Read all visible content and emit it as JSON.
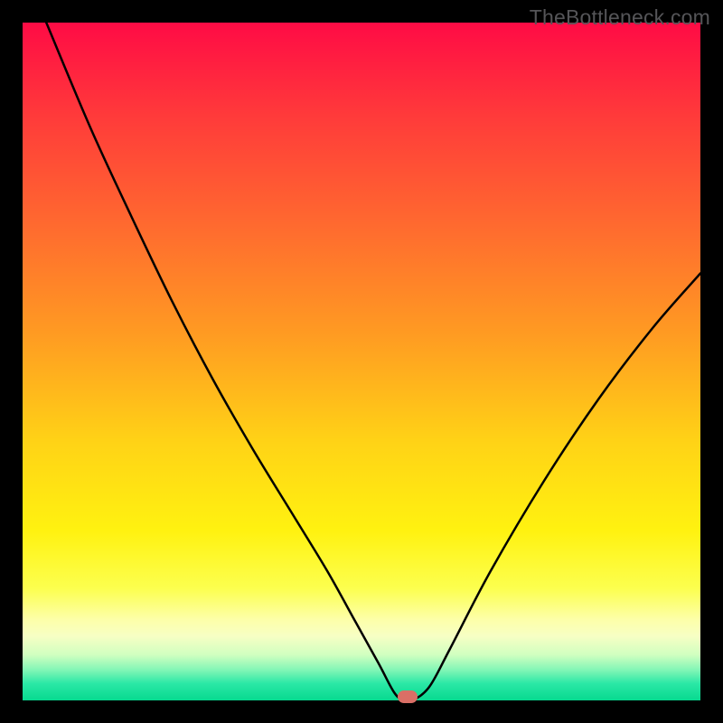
{
  "watermark": "TheBottleneck.com",
  "colors": {
    "frame": "#000000",
    "curve": "#000000",
    "marker": "#da6f66",
    "gradient_stops": [
      {
        "offset": 0.0,
        "hex": "#ff0b45"
      },
      {
        "offset": 0.14,
        "hex": "#ff3b3a"
      },
      {
        "offset": 0.3,
        "hex": "#ff6a2f"
      },
      {
        "offset": 0.46,
        "hex": "#ff9b22"
      },
      {
        "offset": 0.62,
        "hex": "#ffd316"
      },
      {
        "offset": 0.75,
        "hex": "#fff210"
      },
      {
        "offset": 0.835,
        "hex": "#fcff4f"
      },
      {
        "offset": 0.88,
        "hex": "#fdffa8"
      },
      {
        "offset": 0.905,
        "hex": "#f7ffc4"
      },
      {
        "offset": 0.933,
        "hex": "#d0ffc0"
      },
      {
        "offset": 0.955,
        "hex": "#82f6b6"
      },
      {
        "offset": 0.975,
        "hex": "#2be8a6"
      },
      {
        "offset": 1.0,
        "hex": "#07d98f"
      }
    ]
  },
  "chart_data": {
    "type": "line",
    "title": "",
    "xlabel": "",
    "ylabel": "",
    "xlim": [
      0,
      1
    ],
    "ylim": [
      0,
      1
    ],
    "grid": false,
    "legend": false,
    "annotations": [],
    "series": [
      {
        "name": "bottleneck-curve",
        "x": [
          0.035,
          0.1,
          0.16,
          0.22,
          0.28,
          0.34,
          0.4,
          0.45,
          0.49,
          0.525,
          0.548,
          0.562,
          0.575,
          0.6,
          0.63,
          0.69,
          0.77,
          0.85,
          0.93,
          1.0
        ],
        "y": [
          1.0,
          0.845,
          0.715,
          0.59,
          0.475,
          0.37,
          0.272,
          0.19,
          0.118,
          0.055,
          0.012,
          0.0,
          0.0,
          0.02,
          0.075,
          0.19,
          0.325,
          0.445,
          0.55,
          0.63
        ]
      }
    ],
    "markers": [
      {
        "name": "min-marker",
        "x": 0.568,
        "y": 0.0
      }
    ]
  }
}
